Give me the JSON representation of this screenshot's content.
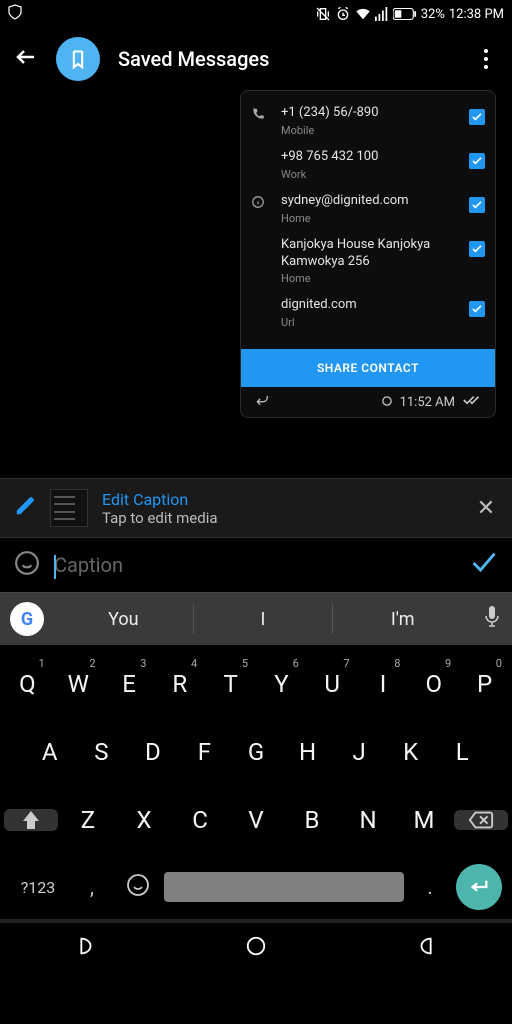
{
  "status": {
    "battery": "32%",
    "time": "12:38 PM"
  },
  "header": {
    "title": "Saved Messages"
  },
  "contact": {
    "rows": [
      {
        "value": "+1 (234) 56/-890",
        "label": "Mobile",
        "icon": "phone"
      },
      {
        "value": "+98 765 432 100",
        "label": "Work",
        "icon": ""
      },
      {
        "value": "sydney@dignited.com",
        "label": "Home",
        "icon": "info"
      },
      {
        "value": "Kanjokya House Kanjokya Kamwokya 256",
        "label": "Home",
        "icon": ""
      },
      {
        "value": "dignited.com",
        "label": "Url",
        "icon": ""
      }
    ],
    "share_label": "SHARE CONTACT",
    "timestamp": "11:52 AM"
  },
  "edit": {
    "title": "Edit Caption",
    "subtitle": "Tap to edit media"
  },
  "caption": {
    "placeholder": "Caption"
  },
  "keyboard": {
    "suggestions": [
      "You",
      "I",
      "I'm"
    ],
    "row1": [
      "Q",
      "W",
      "E",
      "R",
      "T",
      "Y",
      "U",
      "I",
      "O",
      "P"
    ],
    "nums": [
      "1",
      "2",
      "3",
      "4",
      "5",
      "6",
      "7",
      "8",
      "9",
      "0"
    ],
    "row2": [
      "A",
      "S",
      "D",
      "F",
      "G",
      "H",
      "J",
      "K",
      "L"
    ],
    "row3": [
      "Z",
      "X",
      "C",
      "V",
      "B",
      "N",
      "M"
    ],
    "symbols_label": "?123",
    "comma": ",",
    "period": "."
  }
}
